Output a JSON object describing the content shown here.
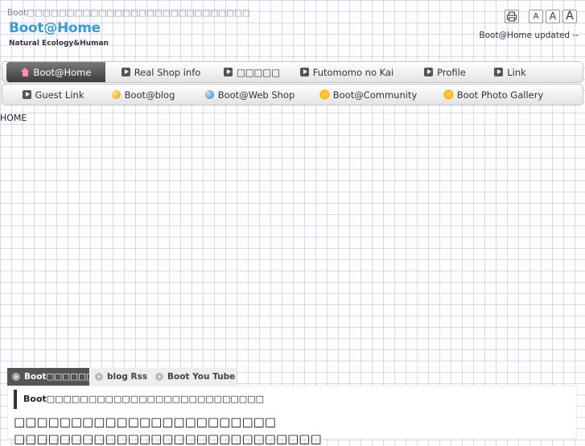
{
  "header": {
    "tagline": "Boot□□□□□□□□□□□□□□□□□□□□□□□□□□□□",
    "logo": "Boot@Home",
    "subtitle": "Natural  Ecology&Human",
    "updated": "Boot@Home updated --",
    "font_sizes": [
      "A",
      "A",
      "A"
    ]
  },
  "nav": {
    "row1": [
      {
        "label": "Boot@Home",
        "icon": "home-icon",
        "active": true
      },
      {
        "label": "Real Shop info",
        "icon": "play-icon"
      },
      {
        "label": "□□□□□",
        "icon": "play-icon"
      },
      {
        "label": "Futomomo no Kai",
        "icon": "play-icon"
      },
      {
        "label": "Profile",
        "icon": "play-icon"
      },
      {
        "label": "Link",
        "icon": "play-icon"
      }
    ],
    "row2": [
      {
        "label": "Guest Link",
        "icon": "play-icon"
      },
      {
        "label": "Boot@blog",
        "icon": "moon-icon"
      },
      {
        "label": "Boot@Web Shop",
        "icon": "globe-icon"
      },
      {
        "label": "Boot@Community",
        "icon": "sun-icon"
      },
      {
        "label": "Boot Photo Gallery",
        "icon": "sun-icon"
      }
    ]
  },
  "breadcrumb": "HOME",
  "tabs": [
    {
      "label": "Boot□□□□□□□□",
      "active": true
    },
    {
      "label": "blog Rss"
    },
    {
      "label": "Boot You Tube"
    }
  ],
  "content": {
    "box_heading": "Boot□□□□□□□□□□□□□□□□□□□□□□□□□□",
    "heading_1": "□□□□□□□□□□□□□□□□□□□□□□□",
    "heading_2": "□□□□□□□□□□□□□□□□□□□□□□□□□□□"
  },
  "colors": {
    "logo": "#3a9bd8",
    "grid": "#9696d2",
    "nav_active": "#4a4a4a"
  }
}
